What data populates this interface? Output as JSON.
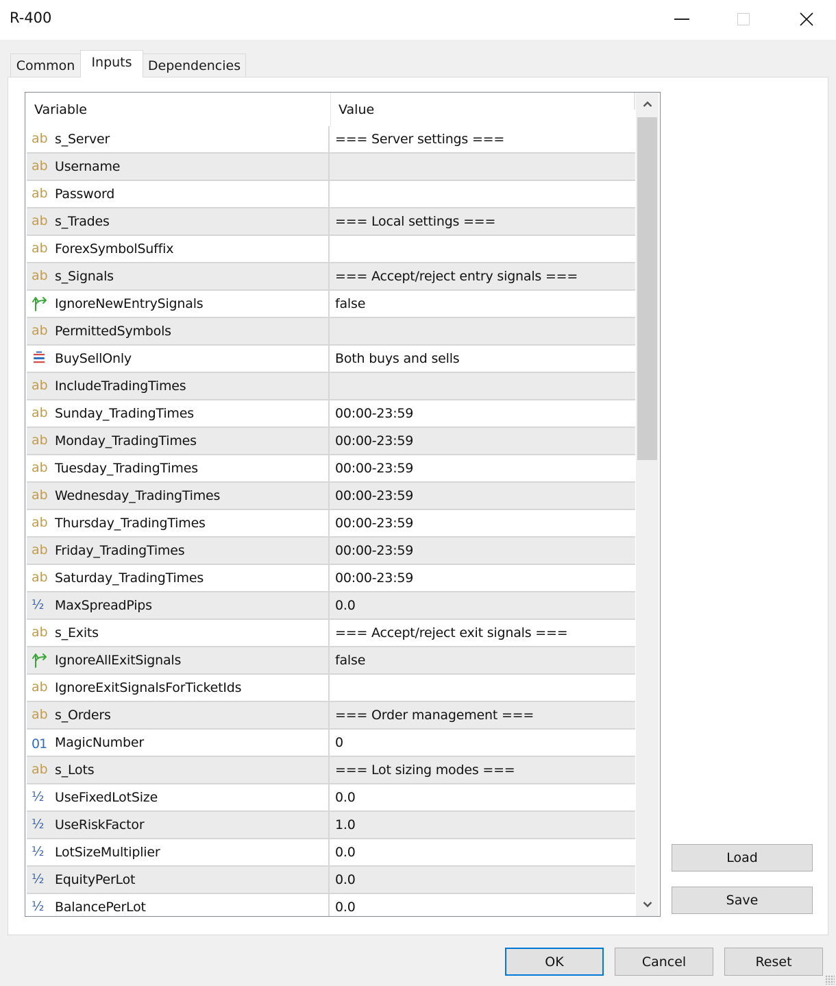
{
  "window": {
    "title": "R-400",
    "controls": {
      "minimize": "minimize",
      "maximize": "maximize",
      "close": "close"
    }
  },
  "tabs": [
    {
      "label": "Common",
      "selected": false
    },
    {
      "label": "Inputs",
      "selected": true
    },
    {
      "label": "Dependencies",
      "selected": false
    }
  ],
  "table": {
    "columns": {
      "variable": "Variable",
      "value": "Value"
    },
    "rows": [
      {
        "type": "string",
        "icon": "ab",
        "name": "s_Server",
        "value": "=== Server settings ==="
      },
      {
        "type": "string",
        "icon": "ab",
        "name": "Username",
        "value": ""
      },
      {
        "type": "string",
        "icon": "ab",
        "name": "Password",
        "value": ""
      },
      {
        "type": "string",
        "icon": "ab",
        "name": "s_Trades",
        "value": "=== Local settings ==="
      },
      {
        "type": "string",
        "icon": "ab",
        "name": "ForexSymbolSuffix",
        "value": ""
      },
      {
        "type": "string",
        "icon": "ab",
        "name": "s_Signals",
        "value": "=== Accept/reject entry signals ==="
      },
      {
        "type": "bool",
        "icon": "bool",
        "name": "IgnoreNewEntrySignals",
        "value": "false"
      },
      {
        "type": "string",
        "icon": "ab",
        "name": "PermittedSymbols",
        "value": ""
      },
      {
        "type": "enum",
        "icon": "enum",
        "name": "BuySellOnly",
        "value": "Both buys and sells"
      },
      {
        "type": "string",
        "icon": "ab",
        "name": "IncludeTradingTimes",
        "value": ""
      },
      {
        "type": "string",
        "icon": "ab",
        "name": "Sunday_TradingTimes",
        "value": "00:00-23:59"
      },
      {
        "type": "string",
        "icon": "ab",
        "name": "Monday_TradingTimes",
        "value": "00:00-23:59"
      },
      {
        "type": "string",
        "icon": "ab",
        "name": "Tuesday_TradingTimes",
        "value": "00:00-23:59"
      },
      {
        "type": "string",
        "icon": "ab",
        "name": "Wednesday_TradingTimes",
        "value": "00:00-23:59"
      },
      {
        "type": "string",
        "icon": "ab",
        "name": "Thursday_TradingTimes",
        "value": "00:00-23:59"
      },
      {
        "type": "string",
        "icon": "ab",
        "name": "Friday_TradingTimes",
        "value": "00:00-23:59"
      },
      {
        "type": "string",
        "icon": "ab",
        "name": "Saturday_TradingTimes",
        "value": "00:00-23:59"
      },
      {
        "type": "double",
        "icon": "half",
        "name": "MaxSpreadPips",
        "value": "0.0"
      },
      {
        "type": "string",
        "icon": "ab",
        "name": "s_Exits",
        "value": "=== Accept/reject exit signals ==="
      },
      {
        "type": "bool",
        "icon": "bool",
        "name": "IgnoreAllExitSignals",
        "value": "false"
      },
      {
        "type": "string",
        "icon": "ab",
        "name": "IgnoreExitSignalsForTicketIds",
        "value": ""
      },
      {
        "type": "string",
        "icon": "ab",
        "name": "s_Orders",
        "value": "=== Order management ==="
      },
      {
        "type": "int",
        "icon": "int",
        "name": "MagicNumber",
        "value": "0"
      },
      {
        "type": "string",
        "icon": "ab",
        "name": "s_Lots",
        "value": "=== Lot sizing modes ==="
      },
      {
        "type": "double",
        "icon": "half",
        "name": "UseFixedLotSize",
        "value": "0.0"
      },
      {
        "type": "double",
        "icon": "half",
        "name": "UseRiskFactor",
        "value": "1.0"
      },
      {
        "type": "double",
        "icon": "half",
        "name": "LotSizeMultiplier",
        "value": "0.0"
      },
      {
        "type": "double",
        "icon": "half",
        "name": "EquityPerLot",
        "value": "0.0"
      },
      {
        "type": "double",
        "icon": "half",
        "name": "BalancePerLot",
        "value": "0.0"
      }
    ],
    "scroll_position": 0
  },
  "side_buttons": {
    "load": "Load",
    "save": "Save"
  },
  "footer_buttons": {
    "ok": "OK",
    "cancel": "Cancel",
    "reset": "Reset"
  },
  "icon_glyphs": {
    "ab": "ab",
    "half": "½",
    "int": "01"
  },
  "colors": {
    "string_icon": "#c29b4f",
    "bool_icon": "#3aa63a",
    "double_icon": "#3a64a6",
    "int_icon": "#2f6fc0",
    "default_button_border": "#0078d7"
  }
}
